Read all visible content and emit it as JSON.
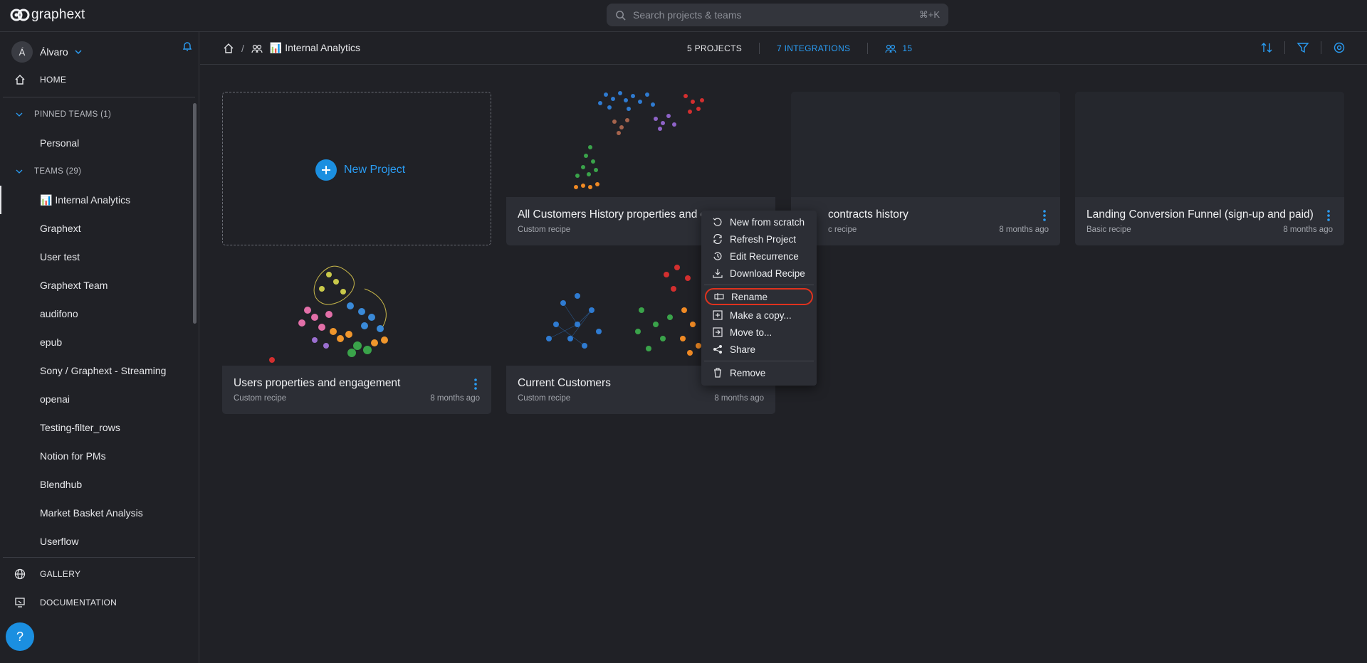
{
  "app": {
    "logo_text": "graphext"
  },
  "search": {
    "placeholder": "Search projects & teams",
    "shortcut": "⌘+K"
  },
  "user": {
    "initial": "Á",
    "name": "Álvaro"
  },
  "nav": {
    "home": "HOME",
    "gallery": "GALLERY",
    "documentation": "DOCUMENTATION",
    "help": "?"
  },
  "sidebar": {
    "pinned_header": "PINNED TEAMS (1)",
    "pinned": [
      "Personal"
    ],
    "teams_header": "TEAMS (29)",
    "teams": [
      "📊 Internal Analytics",
      "Graphext",
      "User test",
      "Graphext Team",
      "audifono",
      "epub",
      "Sony / Graphext - Streaming",
      "openai",
      "Testing-filter_rows",
      "Notion for PMs",
      "Blendhub",
      "Market Basket Analysis",
      "Userflow"
    ]
  },
  "breadcrumb": {
    "team": "📊 Internal Analytics"
  },
  "stats": {
    "projects": "5 PROJECTS",
    "integrations": "7 INTEGRATIONS",
    "members": "15"
  },
  "new_project": {
    "label": "New Project"
  },
  "projects": [
    {
      "title": "All Customers History properties and engagement",
      "recipe": "Custom recipe",
      "time": ""
    },
    {
      "title": "contracts history",
      "recipe": "c recipe",
      "time": "8 months ago"
    },
    {
      "title": "Landing Conversion Funnel (sign-up and paid)",
      "recipe": "Basic recipe",
      "time": "8 months ago"
    },
    {
      "title": "Users properties and engagement",
      "recipe": "Custom recipe",
      "time": "8 months ago"
    },
    {
      "title": "Current Customers",
      "recipe": "Custom recipe",
      "time": "8 months ago"
    }
  ],
  "context_menu": {
    "new_from_scratch": "New from scratch",
    "refresh": "Refresh Project",
    "edit_recurrence": "Edit Recurrence",
    "download": "Download Recipe",
    "rename": "Rename",
    "make_copy": "Make a copy...",
    "move_to": "Move to...",
    "share": "Share",
    "remove": "Remove"
  },
  "colors": {
    "accent": "#1b8fe0",
    "background": "#202126",
    "card": "#2a2c33",
    "highlight": "#e0321e"
  }
}
